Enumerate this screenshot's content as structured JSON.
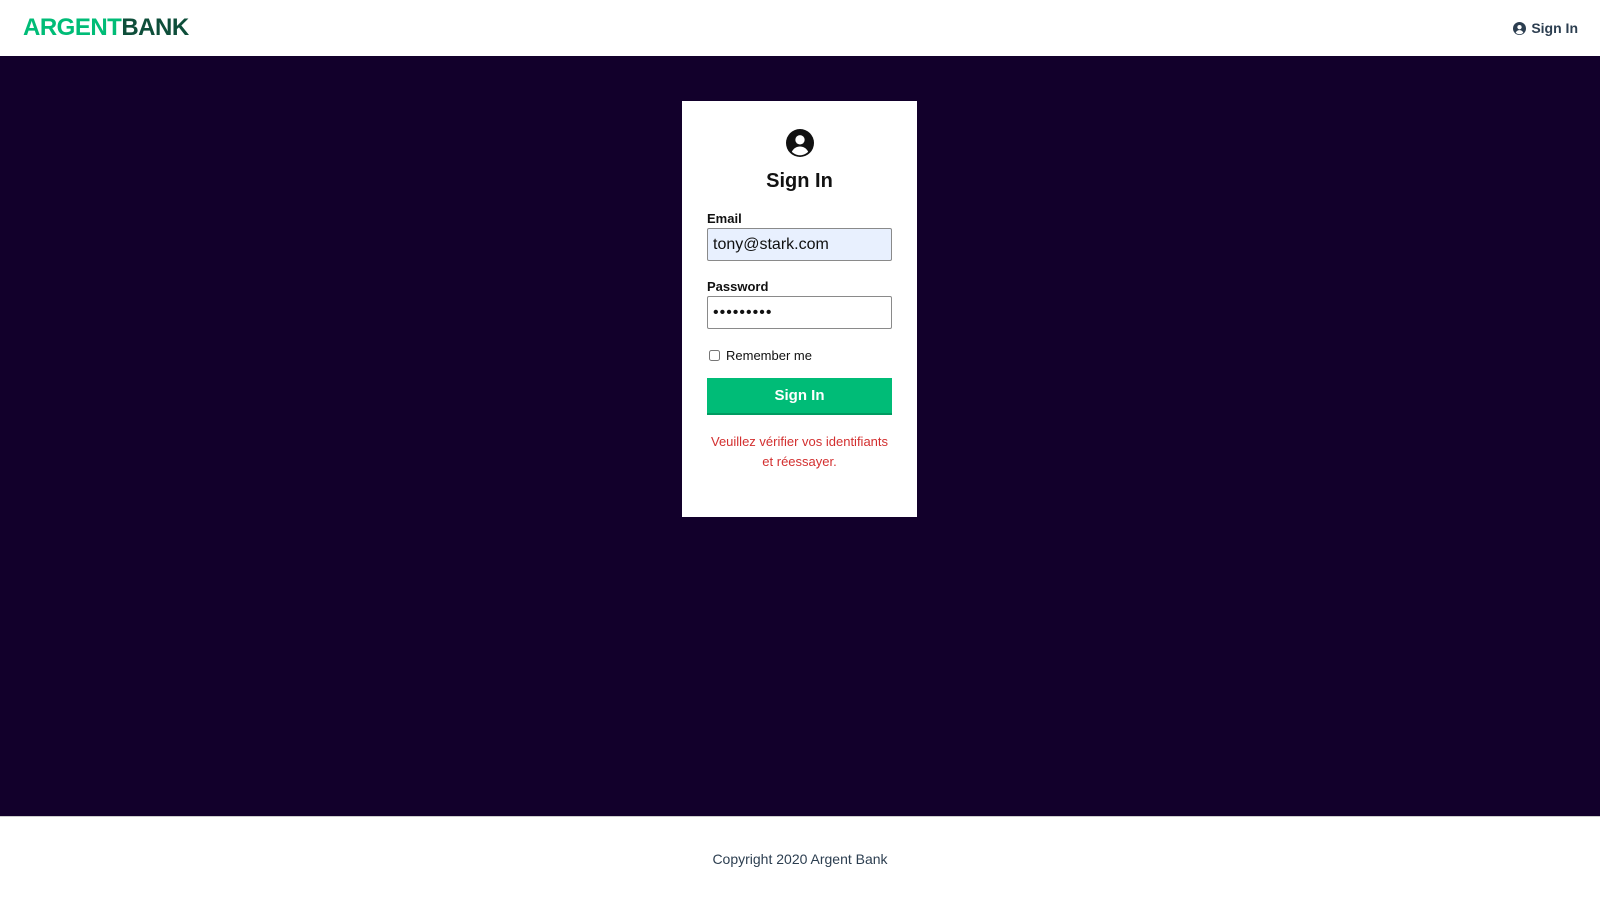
{
  "header": {
    "logo_part1": "ARGENT",
    "logo_part2": "BANK",
    "signin_link": "Sign In",
    "signin_icon": "user-circle-icon"
  },
  "signin_form": {
    "icon": "user-circle-icon",
    "title": "Sign In",
    "email_label": "Email",
    "email_value": "tony@stark.com",
    "password_label": "Password",
    "password_value": "•••••••••",
    "remember_label": "Remember me",
    "remember_checked": false,
    "submit_label": "Sign In",
    "error_message": "Veuillez vérifier vos identifiants et réessayer."
  },
  "footer": {
    "copyright": "Copyright 2020 Argent Bank"
  },
  "colors": {
    "brand_green": "#00bc77",
    "brand_dark_green": "#0e4e3a",
    "background_dark": "#12002b",
    "error_red": "#d32f2f"
  }
}
